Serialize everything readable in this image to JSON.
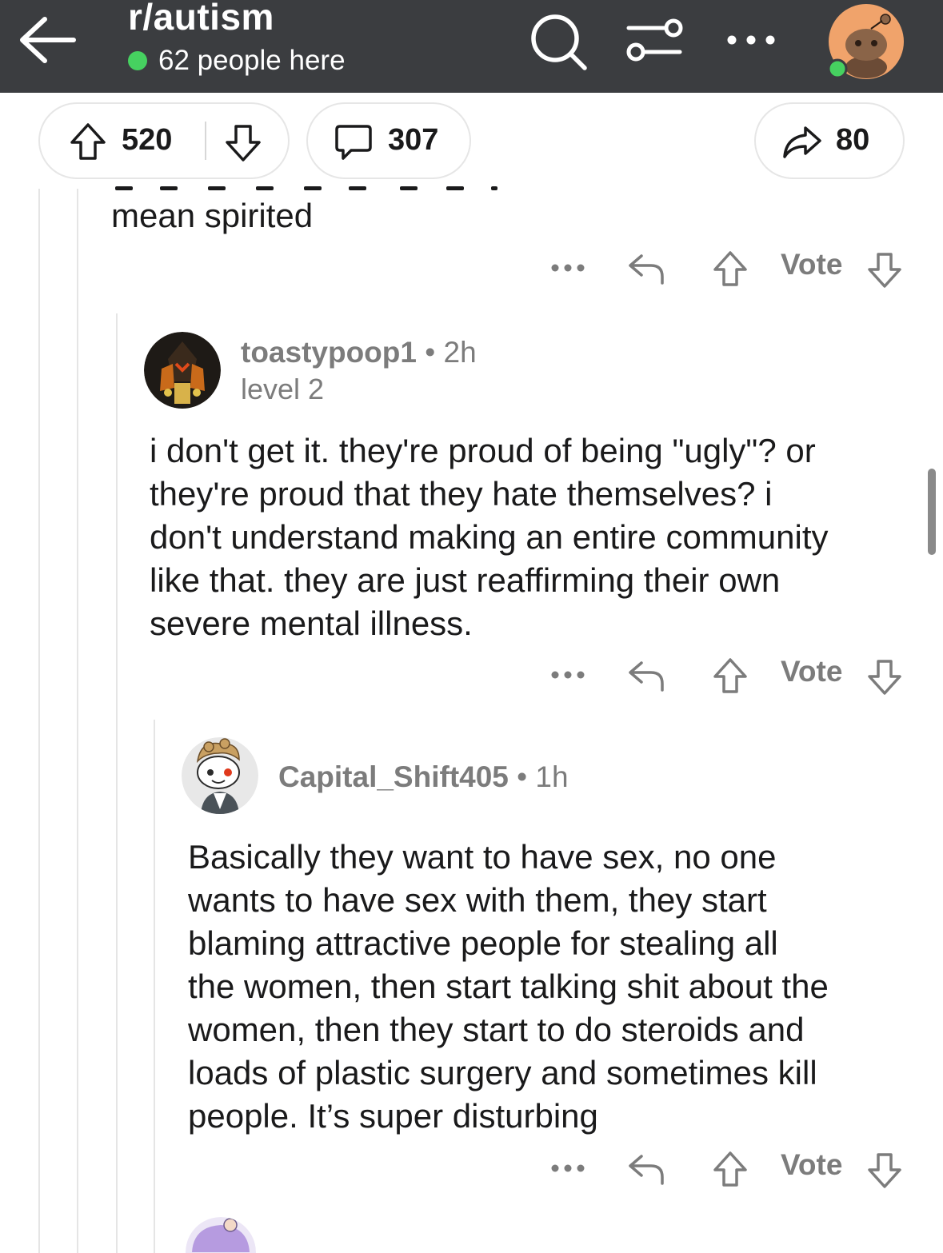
{
  "header": {
    "subreddit": "r/autism",
    "online_count": "62 people here",
    "colors": {
      "bar": "#3b3d40",
      "online_dot": "#46d160"
    },
    "icons": [
      "back-arrow-icon",
      "search-icon",
      "filter-icon",
      "more-options-icon",
      "user-avatar"
    ]
  },
  "post_actions": {
    "upvotes": "520",
    "comments": "307",
    "shares": "80"
  },
  "comments": [
    {
      "text_tail": "mean spirited",
      "vote_label": "Vote"
    },
    {
      "username": "toastypoop1",
      "separator": "•",
      "time": "2h",
      "level": "level 2",
      "lines": [
        "i don't get it. they're proud of being \"ugly\"? or",
        "they're proud that they hate themselves? i",
        "don't understand making an entire community",
        "like that. they are just reaffirming their own",
        "severe mental illness."
      ],
      "vote_label": "Vote"
    },
    {
      "username": "Capital_Shift405",
      "separator": "•",
      "time": "1h",
      "lines": [
        "Basically they want to have sex, no one",
        "wants to have sex with them, they start",
        "blaming attractive people for stealing all",
        "the women, then start talking shit about the",
        "women, then they start to do steroids and",
        "loads of plastic surgery and sometimes kill",
        "people. It’s super disturbing"
      ],
      "vote_label": "Vote"
    }
  ]
}
